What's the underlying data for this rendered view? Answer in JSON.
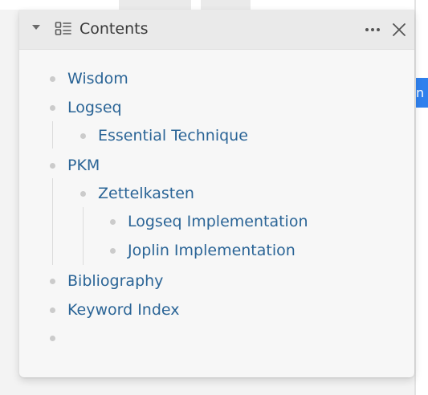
{
  "panel": {
    "title": "Contents",
    "toc_icon": "table-of-contents-icon",
    "collapse_icon": "caret-down-icon",
    "more_icon": "more-horizontal-icon",
    "close_icon": "close-icon"
  },
  "items": [
    {
      "label": "Wisdom"
    },
    {
      "label": "Logseq"
    },
    {
      "label": "Essential Technique"
    },
    {
      "label": "PKM"
    },
    {
      "label": "Zettelkasten"
    },
    {
      "label": "Logseq Implementation"
    },
    {
      "label": "Joplin Implementation"
    },
    {
      "label": "Bibliography"
    },
    {
      "label": "Keyword Index"
    },
    {
      "label": ""
    }
  ],
  "colors": {
    "link": "#2a6496",
    "accent": "#2f80ed",
    "header_bg": "#eaeaea",
    "panel_bg": "#f7f7f7"
  }
}
